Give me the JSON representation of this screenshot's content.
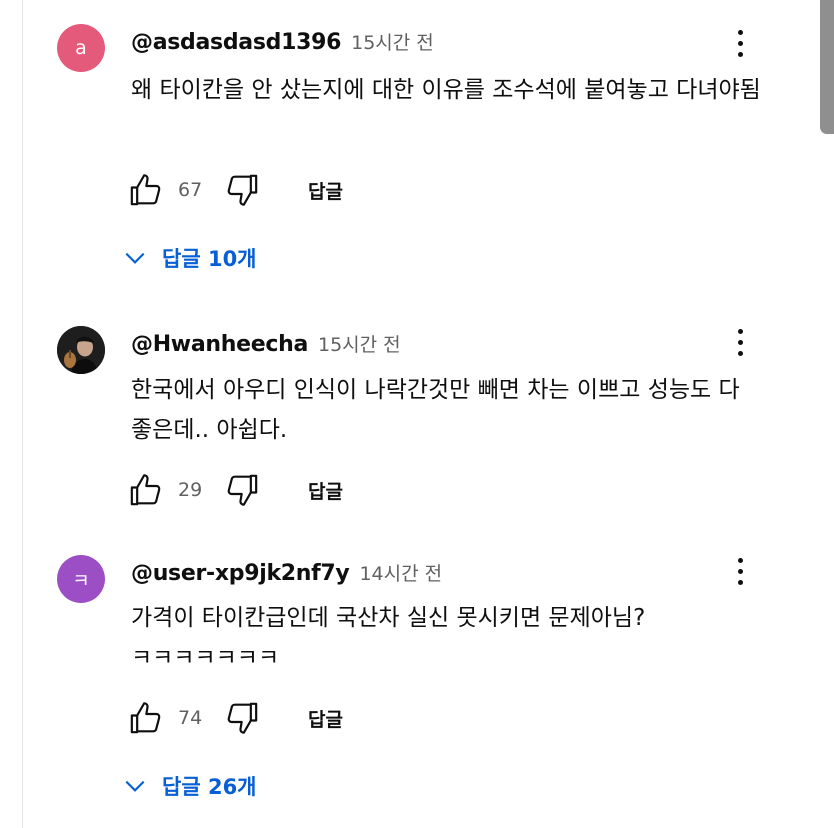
{
  "comments": [
    {
      "avatar_letter": "a",
      "avatar_color": "#e35a7b",
      "author": "@asdasdasd1396",
      "time": "15시간 전",
      "text": "왜 타이칸을 안 샀는지에 대한 이유를 조수석에 붙여놓고 다녀야됨",
      "likes": "67",
      "reply_label": "답글",
      "replies_label": "답글 10개"
    },
    {
      "avatar_letter": "",
      "avatar_color": "#2b2b2b",
      "author": "@Hwanheecha",
      "time": "15시간 전",
      "text": "한국에서 아우디 인식이 나락간것만 빼면 차는 이쁘고 성능도 다 좋은데.. 아쉽다.",
      "likes": "29",
      "reply_label": "답글"
    },
    {
      "avatar_letter": "ㅋ",
      "avatar_color": "#9c4fc4",
      "author": "@user-xp9jk2nf7y",
      "time": "14시간 전",
      "text": "가격이 타이칸급인데 국산차 실신 못시키면 문제아님?ㅋㅋㅋㅋㅋㅋㅋ",
      "likes": "74",
      "reply_label": "답글",
      "replies_label": "답글 26개"
    }
  ],
  "icons": {
    "like": "thumb-up-icon",
    "dislike": "thumb-down-icon",
    "menu": "more-vert-icon",
    "expand": "chevron-down-icon"
  },
  "colors": {
    "link_blue": "#065fd4",
    "secondary_text": "#606060"
  }
}
